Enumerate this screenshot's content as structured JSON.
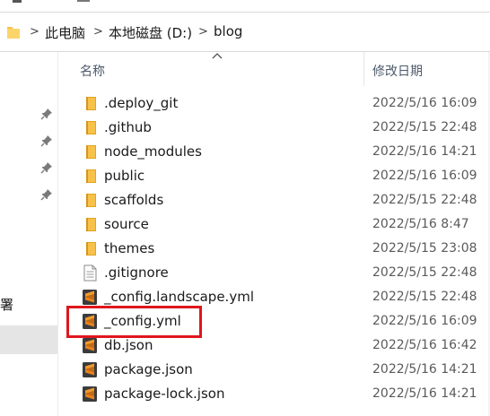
{
  "address_bar": {
    "crumbs": [
      "此电脑",
      "本地磁盘 (D:)",
      "blog"
    ],
    "separator": ">"
  },
  "nav_pane": {
    "fragment_text": "署"
  },
  "columns": {
    "name": "名称",
    "date": "修改日期"
  },
  "files": [
    {
      "name": ".deploy_git",
      "date": "2022/5/16 16:09",
      "icon": "folder-icon"
    },
    {
      "name": ".github",
      "date": "2022/5/15 22:48",
      "icon": "folder-icon"
    },
    {
      "name": "node_modules",
      "date": "2022/5/16 14:21",
      "icon": "folder-icon"
    },
    {
      "name": "public",
      "date": "2022/5/16 16:09",
      "icon": "folder-icon"
    },
    {
      "name": "scaffolds",
      "date": "2022/5/15 22:48",
      "icon": "folder-icon"
    },
    {
      "name": "source",
      "date": "2022/5/16 8:47",
      "icon": "folder-icon"
    },
    {
      "name": "themes",
      "date": "2022/5/15 23:08",
      "icon": "folder-icon"
    },
    {
      "name": ".gitignore",
      "date": "2022/5/15 22:48",
      "icon": "text-file-icon"
    },
    {
      "name": "_config.landscape.yml",
      "date": "2022/5/15 22:48",
      "icon": "sublime-file-icon"
    },
    {
      "name": "_config.yml",
      "date": "2022/5/16 16:09",
      "icon": "sublime-file-icon"
    },
    {
      "name": "db.json",
      "date": "2022/5/16 16:42",
      "icon": "sublime-file-icon"
    },
    {
      "name": "package.json",
      "date": "2022/5/16 14:21",
      "icon": "sublime-file-icon"
    },
    {
      "name": "package-lock.json",
      "date": "2022/5/16 14:21",
      "icon": "sublime-file-icon"
    }
  ],
  "highlighted_file": "_config.yml",
  "colors": {
    "folder": "#f8c24a",
    "folder_dark": "#e2a41c",
    "sublime": "#e8821e",
    "highlight": "#e0161d"
  }
}
